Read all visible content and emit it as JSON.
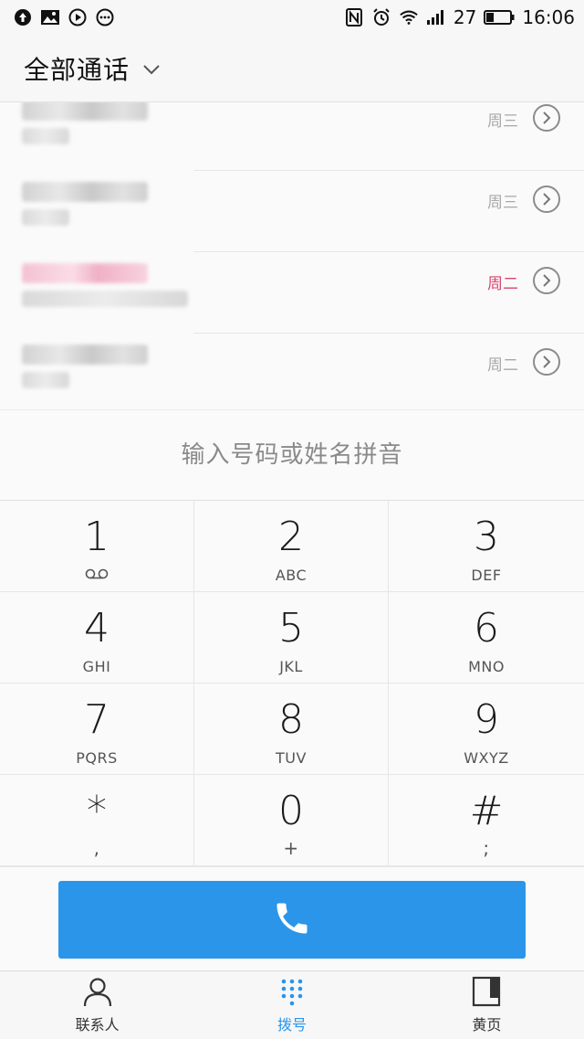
{
  "status_bar": {
    "battery_level": "27",
    "time": "16:06",
    "left_icons": [
      "upload-icon",
      "image-icon",
      "play-icon",
      "more-icon"
    ],
    "right_icons": [
      "nfc-icon",
      "alarm-icon",
      "wifi-icon",
      "signal-icon",
      "battery-icon"
    ]
  },
  "header": {
    "title": "全部通话"
  },
  "call_list": [
    {
      "day": "周三",
      "missed": false
    },
    {
      "day": "周三",
      "missed": false
    },
    {
      "day": "周二",
      "missed": true
    },
    {
      "day": "周二",
      "missed": false
    }
  ],
  "dial_input": {
    "placeholder": "输入号码或姓名拼音"
  },
  "keypad": [
    {
      "digit": "1",
      "sub": "",
      "sub_icon": "voicemail-icon"
    },
    {
      "digit": "2",
      "sub": "ABC"
    },
    {
      "digit": "3",
      "sub": "DEF"
    },
    {
      "digit": "4",
      "sub": "GHI"
    },
    {
      "digit": "5",
      "sub": "JKL"
    },
    {
      "digit": "6",
      "sub": "MNO"
    },
    {
      "digit": "7",
      "sub": "PQRS"
    },
    {
      "digit": "8",
      "sub": "TUV"
    },
    {
      "digit": "9",
      "sub": "WXYZ"
    },
    {
      "digit": "*",
      "sub": ","
    },
    {
      "digit": "0",
      "sub": "+"
    },
    {
      "digit": "#",
      "sub": ";"
    }
  ],
  "bottom_nav": [
    {
      "label": "联系人",
      "icon": "person-icon",
      "active": false
    },
    {
      "label": "拨号",
      "icon": "dialpad-icon",
      "active": true
    },
    {
      "label": "黄页",
      "icon": "yellow-pages-icon",
      "active": false
    }
  ],
  "colors": {
    "accent": "#2b95e9",
    "missed_call": "#d8456f"
  }
}
